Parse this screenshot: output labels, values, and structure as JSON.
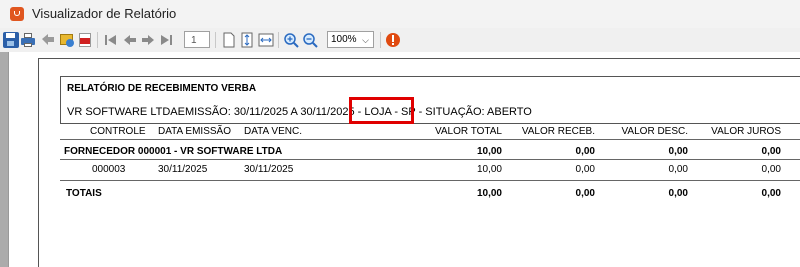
{
  "window": {
    "title": "Visualizador de Relatório"
  },
  "toolbar": {
    "page_number": "1",
    "zoom": "100%"
  },
  "report": {
    "title": "RELATÓRIO DE RECEBIMENTO VERBA",
    "subtitle_prefix": "VR SOFTWARE LTDAEMISSÃO: 30/11/2025 A 30/11/2025",
    "subtitle_highlight": "- LOJA - SP",
    "subtitle_suffix": "- SITUAÇÃO: ABERTO",
    "columns": {
      "controle": "CONTROLE",
      "data_emissao": "DATA EMISSÃO",
      "data_venc": "DATA VENC.",
      "valor_total": "VALOR TOTAL",
      "valor_receb": "VALOR RECEB.",
      "valor_desc": "VALOR DESC.",
      "valor_juros": "VALOR JUROS"
    },
    "group": {
      "label": "FORNECEDOR 000001 - VR SOFTWARE LTDA",
      "valor_total": "10,00",
      "valor_receb": "0,00",
      "valor_desc": "0,00",
      "valor_juros": "0,00"
    },
    "row": {
      "controle": "000003",
      "data_emissao": "30/11/2025",
      "data_venc": "30/11/2025",
      "valor_total": "10,00",
      "valor_receb": "0,00",
      "valor_desc": "0,00",
      "valor_juros": "0,00"
    },
    "totals": {
      "label": "TOTAIS",
      "valor_total": "10,00",
      "valor_receb": "0,00",
      "valor_desc": "0,00",
      "valor_juros": "0,00"
    }
  }
}
